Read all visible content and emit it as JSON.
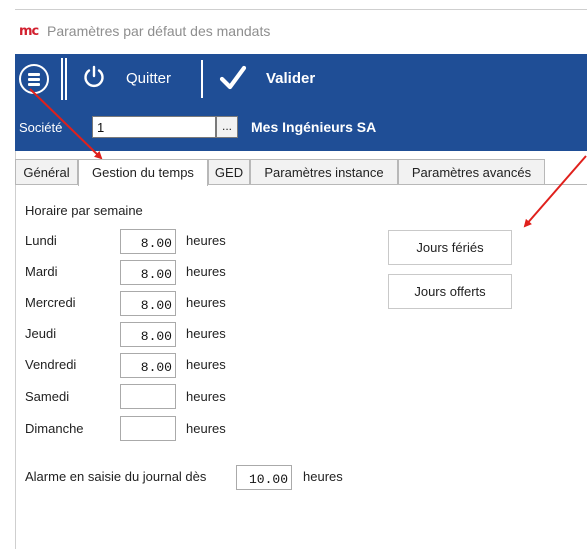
{
  "window": {
    "logo_text": "mc",
    "title": "Paramètres par défaut des mandats"
  },
  "toolbar": {
    "menu_icon": "hamburger-menu-icon",
    "quit_icon": "power-icon",
    "quit_label": "Quitter",
    "validate_icon": "checkmark-icon",
    "validate_label": "Valider",
    "background_color": "#1f4e96"
  },
  "company": {
    "label": "Société",
    "value": "1",
    "browse_label": "...",
    "name": "Mes Ingénieurs SA"
  },
  "tabs": [
    {
      "label": "Général",
      "active": false
    },
    {
      "label": "Gestion du temps",
      "active": true
    },
    {
      "label": "GED",
      "active": false
    },
    {
      "label": "Paramètres instance",
      "active": false
    },
    {
      "label": "Paramètres avancés",
      "active": false
    }
  ],
  "schedule": {
    "title": "Horaire par semaine",
    "unit": "heures",
    "days": [
      {
        "label": "Lundi",
        "value": "8.00"
      },
      {
        "label": "Mardi",
        "value": "8.00"
      },
      {
        "label": "Mercredi",
        "value": "8.00"
      },
      {
        "label": "Jeudi",
        "value": "8.00"
      },
      {
        "label": "Vendredi",
        "value": "8.00"
      },
      {
        "label": "Samedi",
        "value": ""
      },
      {
        "label": "Dimanche",
        "value": ""
      }
    ]
  },
  "buttons": {
    "holidays": "Jours fériés",
    "days_off": "Jours offerts"
  },
  "alarm": {
    "label": "Alarme en saisie du journal dès",
    "value": "10.00",
    "unit": "heures"
  },
  "annotation_color": "#e0201c"
}
